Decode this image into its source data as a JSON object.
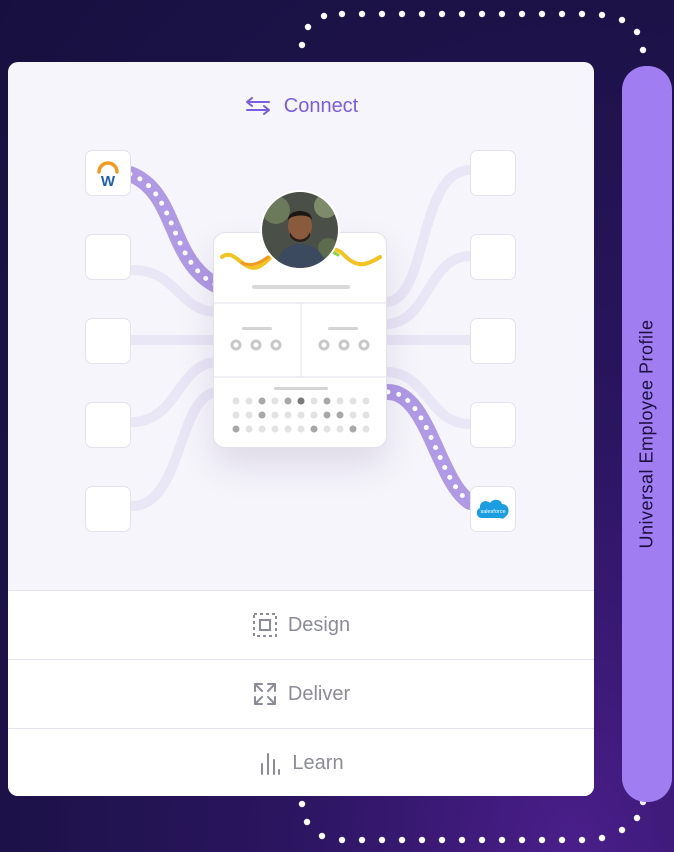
{
  "sidebar": {
    "label": "Universal Employee Profile"
  },
  "steps": {
    "connect": {
      "label": "Connect",
      "icon": "swap-arrows-icon"
    },
    "design": {
      "label": "Design",
      "icon": "dashed-frame-icon"
    },
    "deliver": {
      "label": "Deliver",
      "icon": "expand-arrows-icon"
    },
    "learn": {
      "label": "Learn",
      "icon": "bar-chart-icon"
    }
  },
  "integrations": {
    "workday": {
      "logo_letter": "W",
      "name": "workday-logo"
    },
    "salesforce": {
      "logo_text": "salesforce",
      "name": "salesforce-logo"
    }
  },
  "colors": {
    "accent": "#7a5de3",
    "sidebar": "#a07ef2",
    "background": "#1c1248",
    "card": "#f6f5fb",
    "salesforce_blue": "#1b9de2"
  }
}
